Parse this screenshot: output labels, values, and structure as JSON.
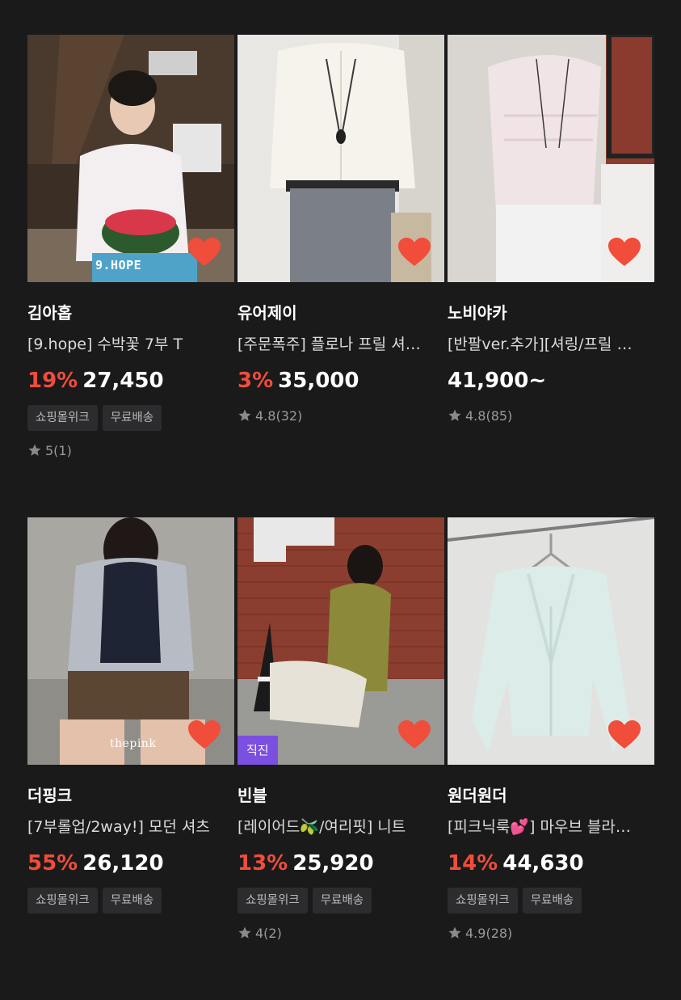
{
  "products": [
    {
      "store": "김아홉",
      "title": "[9.hope] 수박꽃 7부 T",
      "discount": "19%",
      "price": "27,450",
      "tags": [
        "쇼핑몰위크",
        "무료배송"
      ],
      "rating": "5(1)",
      "watermark": "9.HOPE"
    },
    {
      "store": "유어제이",
      "title": "[주문폭주] 플로나 프릴 셔링 블라우스",
      "discount": "3%",
      "price": "35,000",
      "tags": [],
      "rating": "4.8(32)"
    },
    {
      "store": "노비야카",
      "title": "[반팔ver.추가][셔링/프릴 블라우스]",
      "discount": "",
      "price": "41,900~",
      "tags": [],
      "rating": "4.8(85)"
    },
    {
      "store": "더핑크",
      "title": "[7부롤업/2way!] 모던 셔츠",
      "discount": "55%",
      "price": "26,120",
      "tags": [
        "쇼핑몰위크",
        "무료배송"
      ],
      "rating": "",
      "watermark": "thepink"
    },
    {
      "store": "빈블",
      "title": "[레이어드🫒/여리핏] 니트",
      "discount": "13%",
      "price": "25,920",
      "tags": [
        "쇼핑몰위크",
        "무료배송"
      ],
      "rating": "4(2)",
      "badge": "직진"
    },
    {
      "store": "원더원더",
      "title": "[피크닉룩💕] 마우브 블라우스",
      "discount": "14%",
      "price": "44,630",
      "tags": [
        "쇼핑몰위크",
        "무료배송"
      ],
      "rating": "4.9(28)"
    }
  ],
  "icons": {
    "wishlist": "heart-icon",
    "rating": "star-icon"
  },
  "colors": {
    "accent_discount": "#f04d3a",
    "heart": "#f04d3a",
    "badge": "#7b4fe0",
    "background": "#1a1a1b"
  }
}
